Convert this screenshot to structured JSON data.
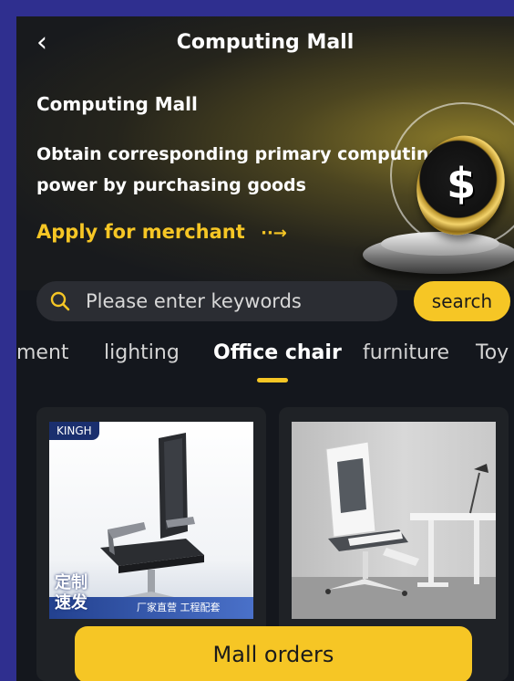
{
  "header": {
    "title": "Computing Mall",
    "back_icon": "chevron-left-icon"
  },
  "banner": {
    "heading": "Computing Mall",
    "description": "Obtain corresponding primary computing power by purchasing goods",
    "apply_label": "Apply for merchant",
    "apply_arrow": "··→",
    "coin_symbol": "$"
  },
  "search": {
    "placeholder": "Please enter keywords",
    "button_label": "search",
    "icon": "search-icon"
  },
  "tabs": [
    {
      "label": "ment"
    },
    {
      "label": "lighting"
    },
    {
      "label": "Office chair",
      "active": true
    },
    {
      "label": "furniture"
    },
    {
      "label": "Toy"
    }
  ],
  "products": [
    {
      "brand": "KINGH",
      "promo_line1": "定制",
      "promo_line2": "速发",
      "promo_sub": "厂家直营 工程配套"
    },
    {}
  ],
  "footer": {
    "orders_label": "Mall orders"
  },
  "colors": {
    "accent": "#f6c625",
    "background": "#14171d",
    "frame": "#2f2f8f"
  }
}
